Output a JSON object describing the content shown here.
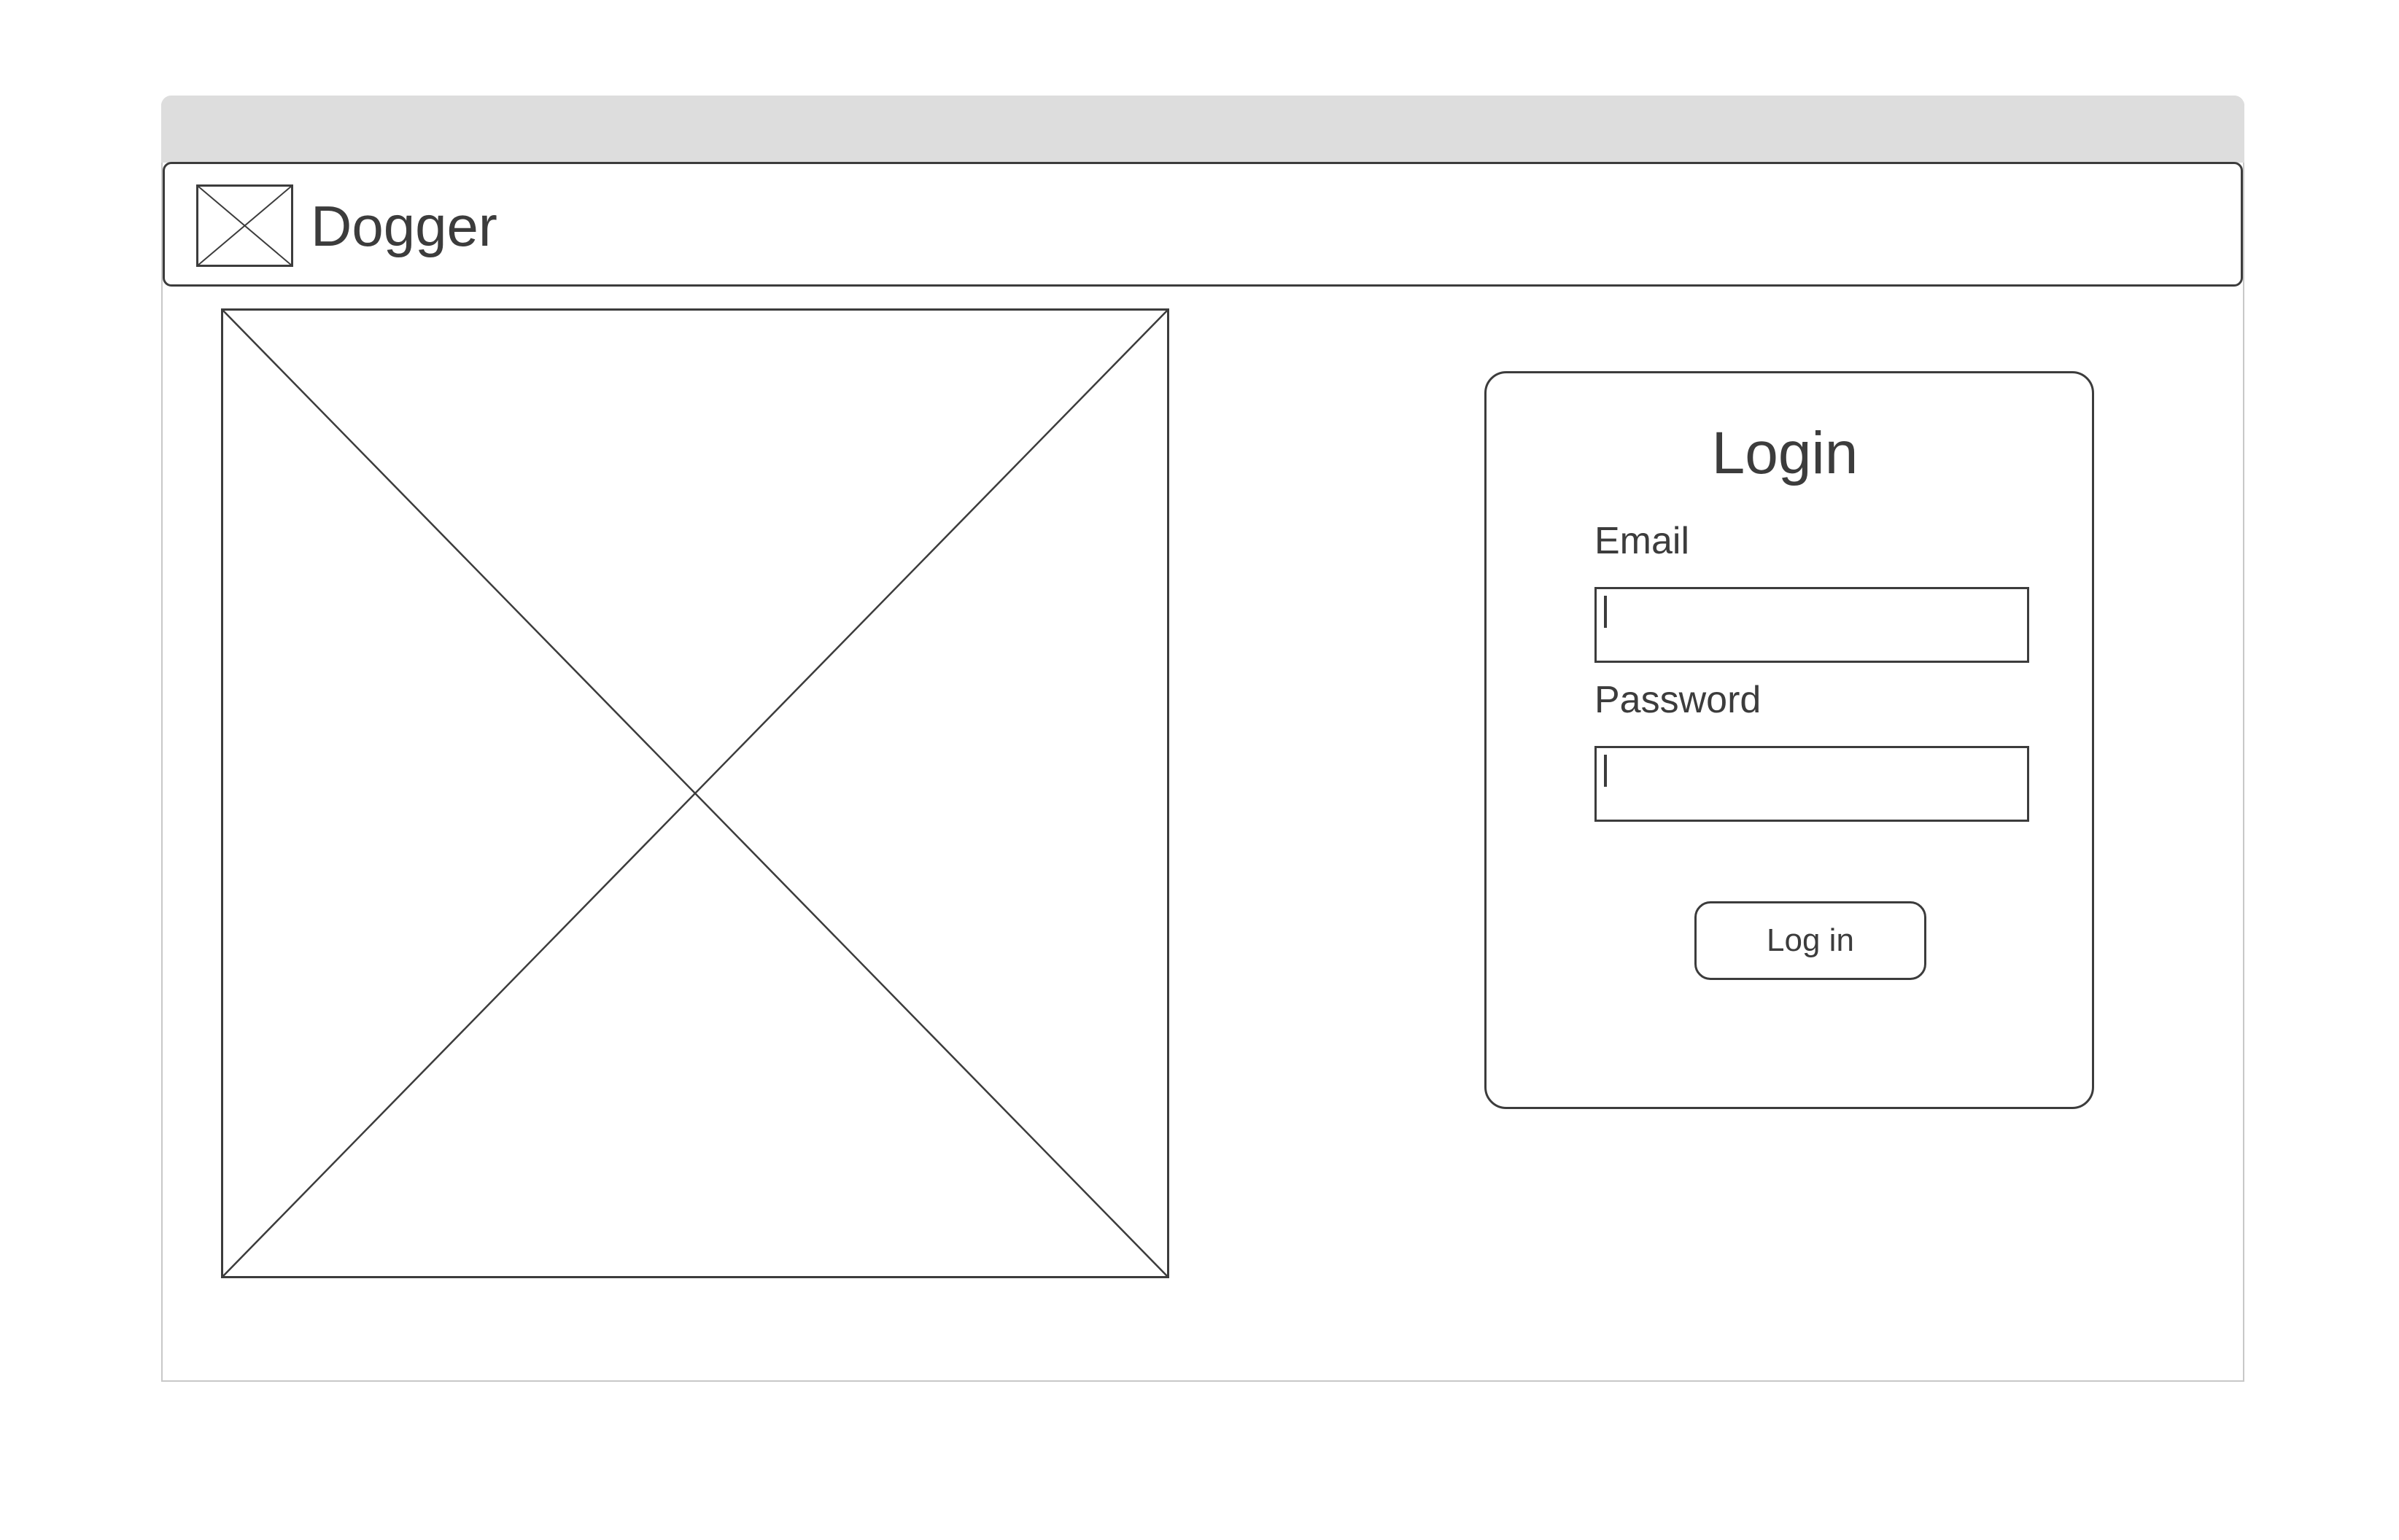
{
  "app": {
    "brand_name": "Dogger",
    "logo_icon": "image-placeholder-icon"
  },
  "hero": {
    "image_icon": "image-placeholder-icon"
  },
  "login": {
    "title": "Login",
    "email_label": "Email",
    "email_value": "",
    "password_label": "Password",
    "password_value": "",
    "submit_label": "Log in"
  },
  "colors": {
    "stroke": "#3c3c3c",
    "titlebar": "#dddddd",
    "window_border": "#c8c8c8",
    "background": "#ffffff"
  }
}
